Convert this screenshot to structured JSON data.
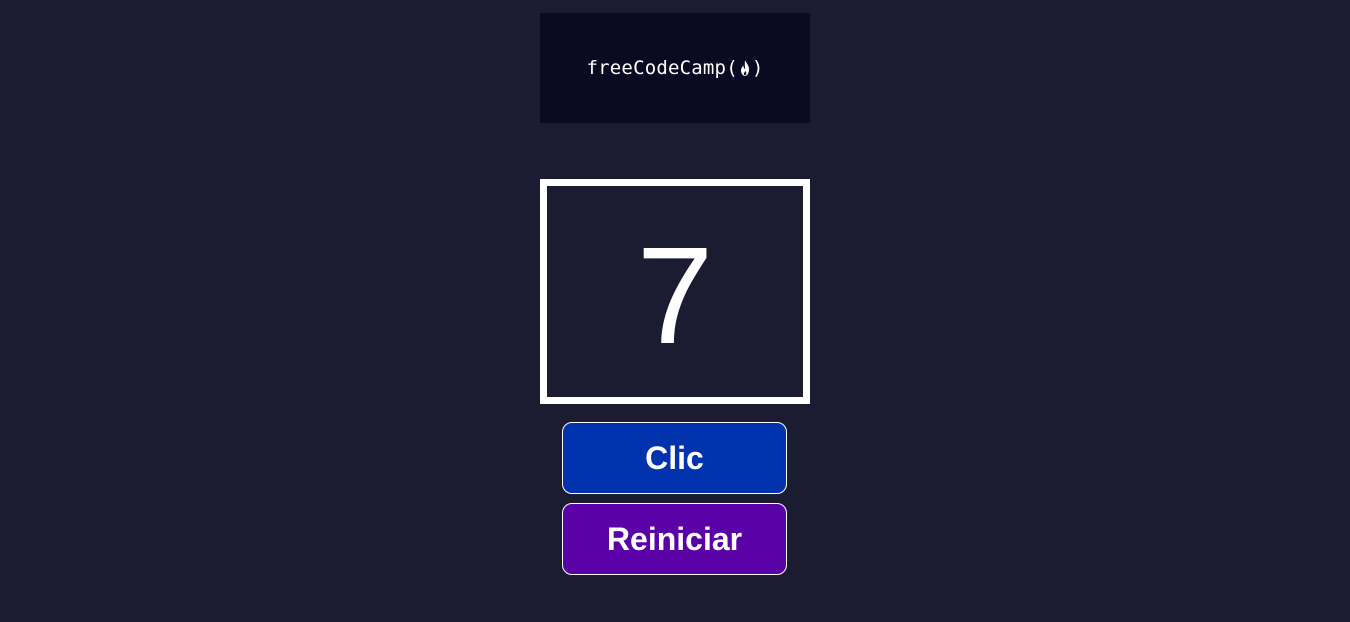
{
  "header": {
    "logo_text": "freeCodeCamp",
    "logo_open_paren": "(",
    "logo_close_paren": ")",
    "logo_icon": "flame-icon"
  },
  "counter": {
    "value": "7"
  },
  "buttons": {
    "click_label": "Clic",
    "reset_label": "Reiniciar"
  },
  "colors": {
    "background": "#1b1b32",
    "logo_background": "#0a0a23",
    "click_button": "#0033ad",
    "reset_button": "#5a01a7",
    "text": "#ffffff"
  }
}
